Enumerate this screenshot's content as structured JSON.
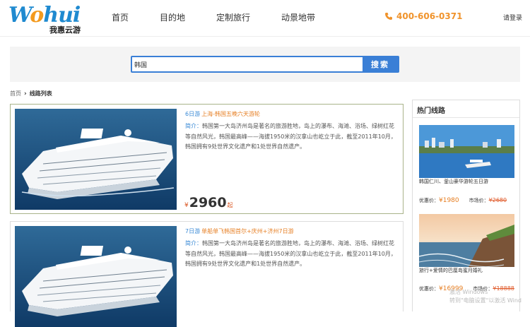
{
  "brand": {
    "logo_text": "Wohui",
    "logo_cn": "我惠云游"
  },
  "nav": {
    "items": [
      "首页",
      "目的地",
      "定制旅行",
      "动景地带"
    ]
  },
  "header": {
    "phone": "400-606-0371",
    "login": "请登录"
  },
  "search": {
    "value": "韩国",
    "button": "搜索"
  },
  "breadcrumb": {
    "home": "首页",
    "current": "线路列表"
  },
  "tours": [
    {
      "days": "6日游",
      "name": "上海-韩国五晚六天游轮",
      "desc_label": "简介：",
      "desc": "韩国第一大岛济州岛是著名的旅游胜地，岛上的瀑布、海滩、浴场、绿树红花等自然风光，韩国最高峰——海拔1950米的汉拿山也屹立于此，截至2011年10月，韩国拥有9处世界文化遗产和1处世界自然遗产。",
      "price_currency": "¥",
      "price": "2960",
      "price_suffix": "起"
    },
    {
      "days": "7日游",
      "name": "单船单飞韩国首尔+庆州+济州7日游",
      "desc_label": "简介：",
      "desc": "韩国第一大岛济州岛是著名的旅游胜地，岛上的瀑布、海滩、浴场、绿树红花等自然风光，韩国最高峰——海拔1950米的汉拿山也屹立于此，截至2011年10月，韩国拥有9处世界文化遗产和1处世界自然遗产。"
    }
  ],
  "sidebar": {
    "title": "热门线路",
    "items": [
      {
        "name": "韩国仁川、釜山豪华游轮五日游",
        "price_label": "优惠价：",
        "price": "¥1980",
        "market_label": "市场价：",
        "market": "¥2680"
      },
      {
        "name": "旅行+爱情的巴厘岛蜜月婚礼",
        "price_label": "优惠价：",
        "price": "¥16999",
        "market_label": "市场价：",
        "market": "¥18888"
      }
    ]
  },
  "watermark": {
    "line1": "激活 Windows",
    "line2": "转到\"电脑设置\"以激活 Wind"
  },
  "colors": {
    "accent_blue": "#3a7fd6",
    "accent_orange": "#f0932b",
    "price_red": "#d9531e"
  }
}
